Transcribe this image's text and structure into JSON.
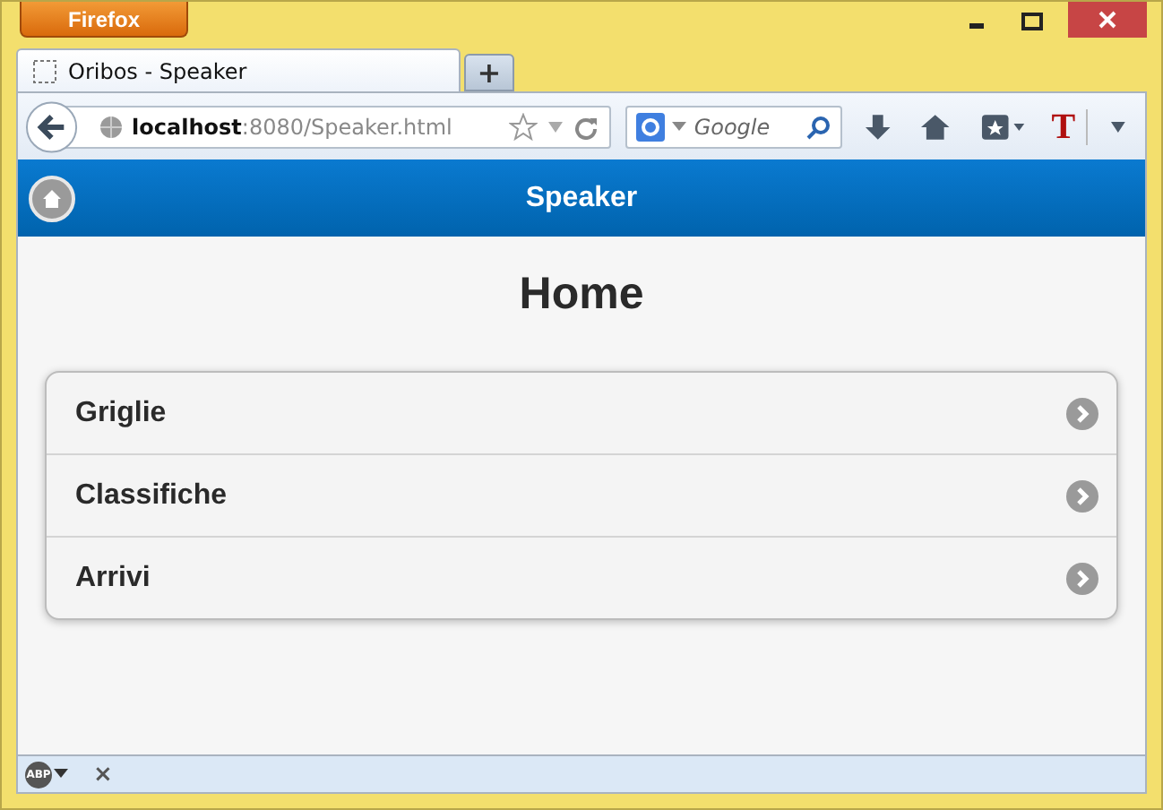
{
  "window": {
    "menu_button": "Firefox"
  },
  "tabs": [
    {
      "label": "Oribos - Speaker",
      "selected": true
    }
  ],
  "new_tab": "+",
  "address": "**localhost**:8080/Speaker.html",
  "search": {
    "placeholder": "Google"
  },
  "addon_button": "T",
  "header": {
    "title": "Speaker"
  },
  "page_title": "Home",
  "items": [
    {
      "label": "Griglie"
    },
    {
      "label": "Classifiche"
    },
    {
      "label": "Arrivi"
    }
  ],
  "addon_bar": {
    "badge": "ABP",
    "close": "×"
  }
}
